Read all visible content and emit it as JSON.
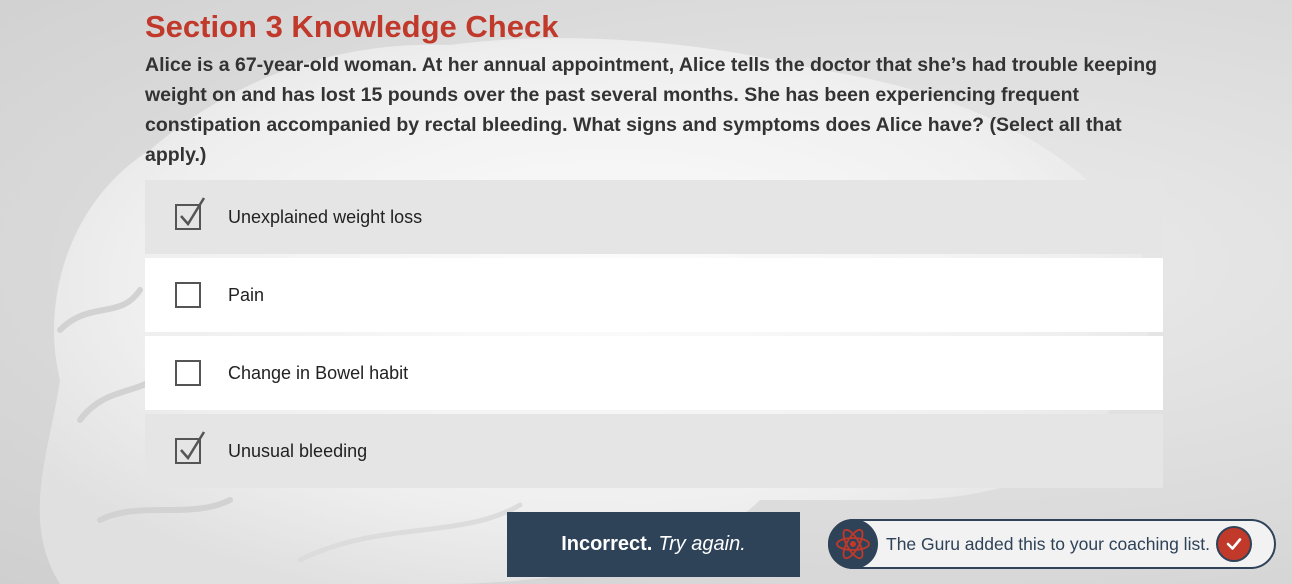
{
  "page": {
    "title": "Section 3 Knowledge Check",
    "question": "Alice is a 67-year-old woman. At her annual appointment, Alice tells the doctor that she’s had trouble keeping weight on and has lost 15 pounds over the past several months. She has been experiencing frequent constipation accompanied by rectal bleeding. What signs and symptoms does Alice have? (Select all that apply.)"
  },
  "options": [
    {
      "label": "Unexplained weight loss",
      "checked": true
    },
    {
      "label": "Pain",
      "checked": false
    },
    {
      "label": "Change in Bowel habit",
      "checked": false
    },
    {
      "label": "Unusual bleeding",
      "checked": true
    }
  ],
  "feedback": {
    "result": "Incorrect.",
    "hint": "Try again."
  },
  "guru": {
    "message": "The Guru added this to your coaching list.",
    "avatar_icon": "atom-icon",
    "check_icon": "check-icon"
  },
  "colors": {
    "accent": "#c0392b",
    "navy": "#2e4258",
    "selected_row": "#e5e5e5",
    "unselected_row": "#ffffff"
  }
}
